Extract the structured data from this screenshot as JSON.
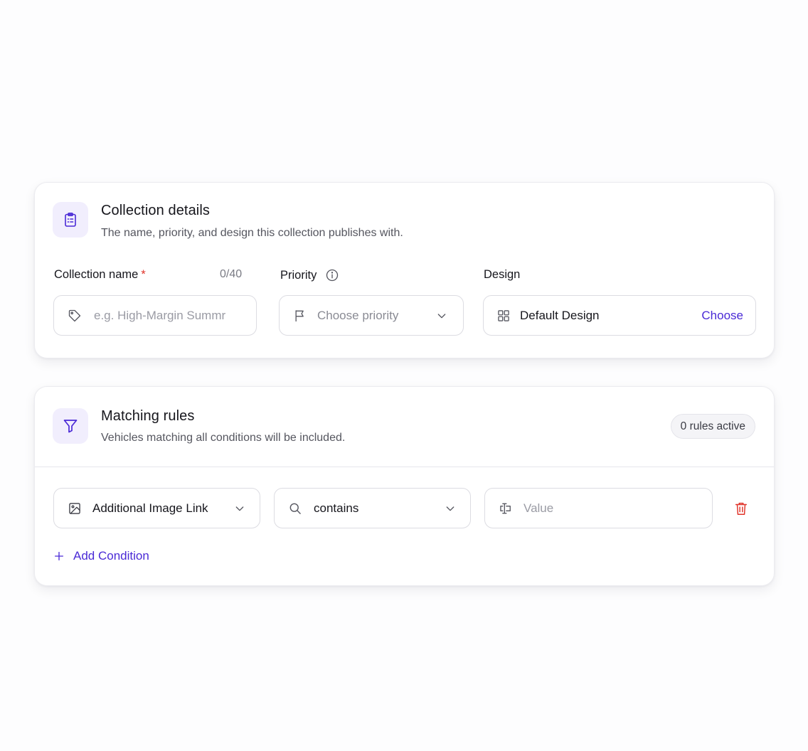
{
  "colors": {
    "accent": "#4a2ad6",
    "icon_bg": "#f1eefd",
    "danger": "#e0352b"
  },
  "details": {
    "icon": "clipboard-icon",
    "title": "Collection details",
    "subtitle": "The name, priority, and design this collection publishes with.",
    "name_label": "Collection name",
    "required_mark": "*",
    "name_counter": "0/40",
    "name_placeholder": "e.g. High-Margin Summr",
    "name_icon": "tag-icon",
    "priority_label": "Priority",
    "priority_info_icon": "info-icon",
    "priority_placeholder": "Choose priority",
    "priority_icon": "flag-icon",
    "design_label": "Design",
    "design_icon": "layout-grid-icon",
    "design_value": "Default Design",
    "design_action": "Choose"
  },
  "rules": {
    "icon": "filter-icon",
    "title": "Matching rules",
    "subtitle": "Vehicles matching all conditions will be included.",
    "badge": "0 rules active",
    "conditions": [
      {
        "field_icon": "image-icon",
        "field": "Additional Image Link",
        "operator_icon": "search-icon",
        "operator": "contains",
        "value_icon": "text-cursor-icon",
        "value_placeholder": "Value",
        "delete_icon": "trash-icon"
      }
    ],
    "add_label": "Add Condition"
  }
}
